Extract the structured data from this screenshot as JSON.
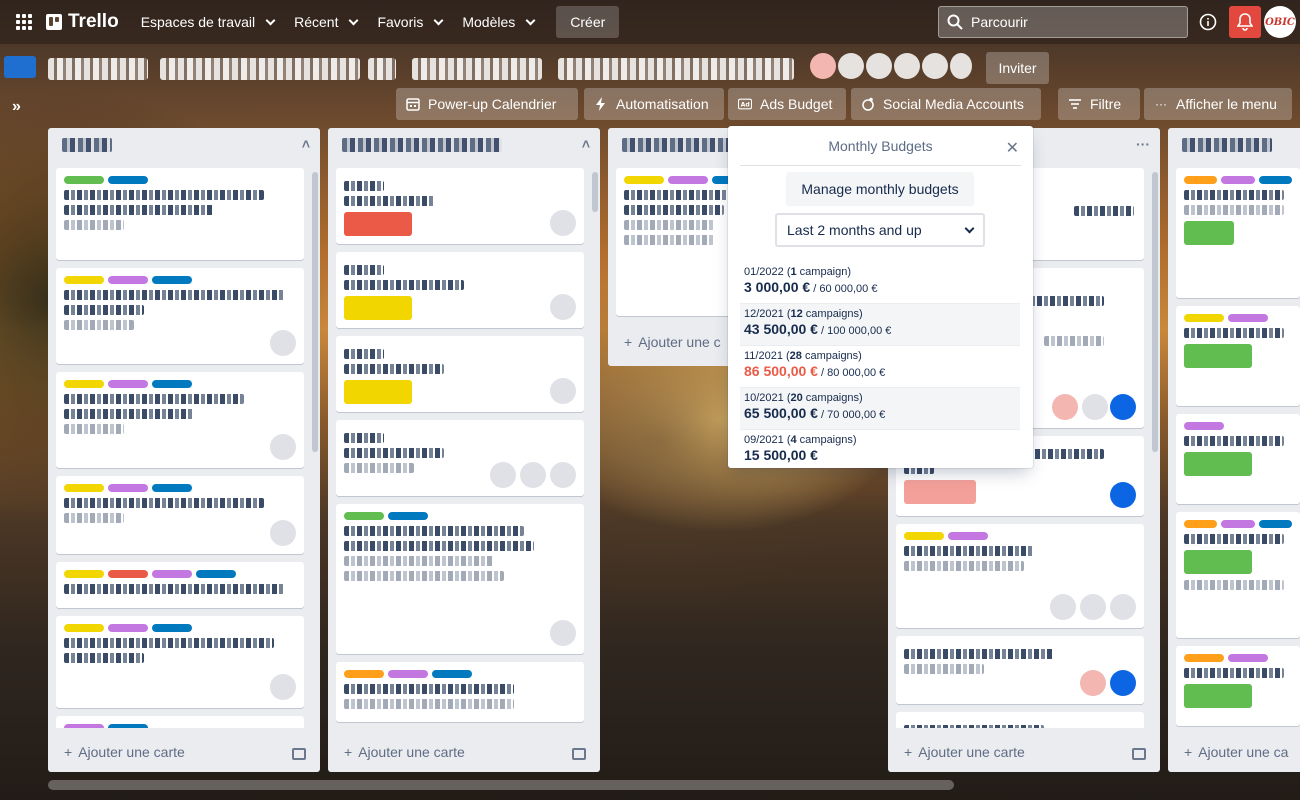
{
  "topbar": {
    "logo": "Trello",
    "nav": [
      "Espaces de travail",
      "Récent",
      "Favoris",
      "Modèles"
    ],
    "create": "Créer",
    "search_placeholder": "Parcourir",
    "avatar_text": "OBIC"
  },
  "board": {
    "invite": "Inviter",
    "powerups": {
      "calendar": "Power-up Calendrier",
      "automation": "Automatisation",
      "ads_budget": "Ads Budget",
      "social": "Social Media Accounts",
      "filter": "Filtre",
      "menu": "Afficher le menu"
    },
    "add_card": "Ajouter une carte",
    "add_card_partial": "Ajouter une c",
    "add_card_partial_2": "Ajouter une ca"
  },
  "popover": {
    "title": "Monthly Budgets",
    "manage": "Manage monthly budgets",
    "filter": "Last 2 months and up",
    "months": [
      {
        "period": "01/2022",
        "count": "1",
        "unit": "campaign",
        "amount": "3 000,00 €",
        "limit": "60 000,00 €",
        "over": false
      },
      {
        "period": "12/2021",
        "count": "12",
        "unit": "campaigns",
        "amount": "43 500,00 €",
        "limit": "100 000,00 €",
        "over": false
      },
      {
        "period": "11/2021",
        "count": "28",
        "unit": "campaigns",
        "amount": "86 500,00 €",
        "limit": "80 000,00 €",
        "over": true
      },
      {
        "period": "10/2021",
        "count": "20",
        "unit": "campaigns",
        "amount": "65 500,00 €",
        "limit": "70 000,00 €",
        "over": false
      },
      {
        "period": "09/2021",
        "count": "4",
        "unit": "campaigns",
        "amount": "15 500,00 €",
        "limit": "",
        "over": false
      }
    ]
  },
  "colors": {
    "green": "#61bd4f",
    "yellow": "#f2d600",
    "orange": "#ff9f1a",
    "red": "#eb5a46",
    "purple": "#c377e0",
    "blue": "#0079bf",
    "sky": "#00c2e0",
    "pink": "#ff78cb"
  }
}
